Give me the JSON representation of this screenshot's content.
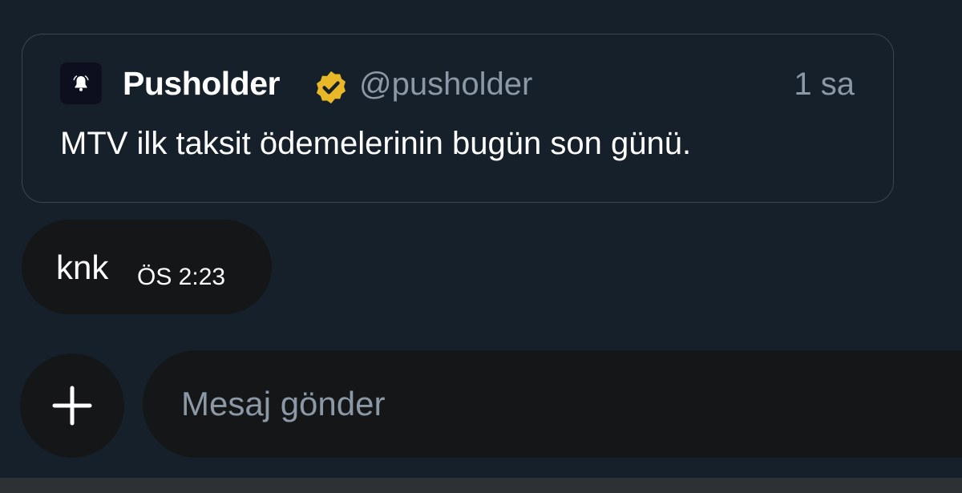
{
  "quoted_post": {
    "avatar_icon": "bell-icon",
    "author_name": "Pusholder",
    "verified_icon": "verified-badge-icon",
    "verified_color": "#e8b829",
    "handle": "@pusholder",
    "time": "1 sa",
    "text": "MTV ilk taksit ödemelerinin bugün son günü."
  },
  "message": {
    "text": "knk",
    "time": "ÖS 2:23"
  },
  "composer": {
    "add_icon": "plus-icon",
    "placeholder": "Mesaj gönder",
    "value": ""
  },
  "colors": {
    "background": "#16202a",
    "bubble": "#141618",
    "muted_text": "#8b98a5"
  }
}
